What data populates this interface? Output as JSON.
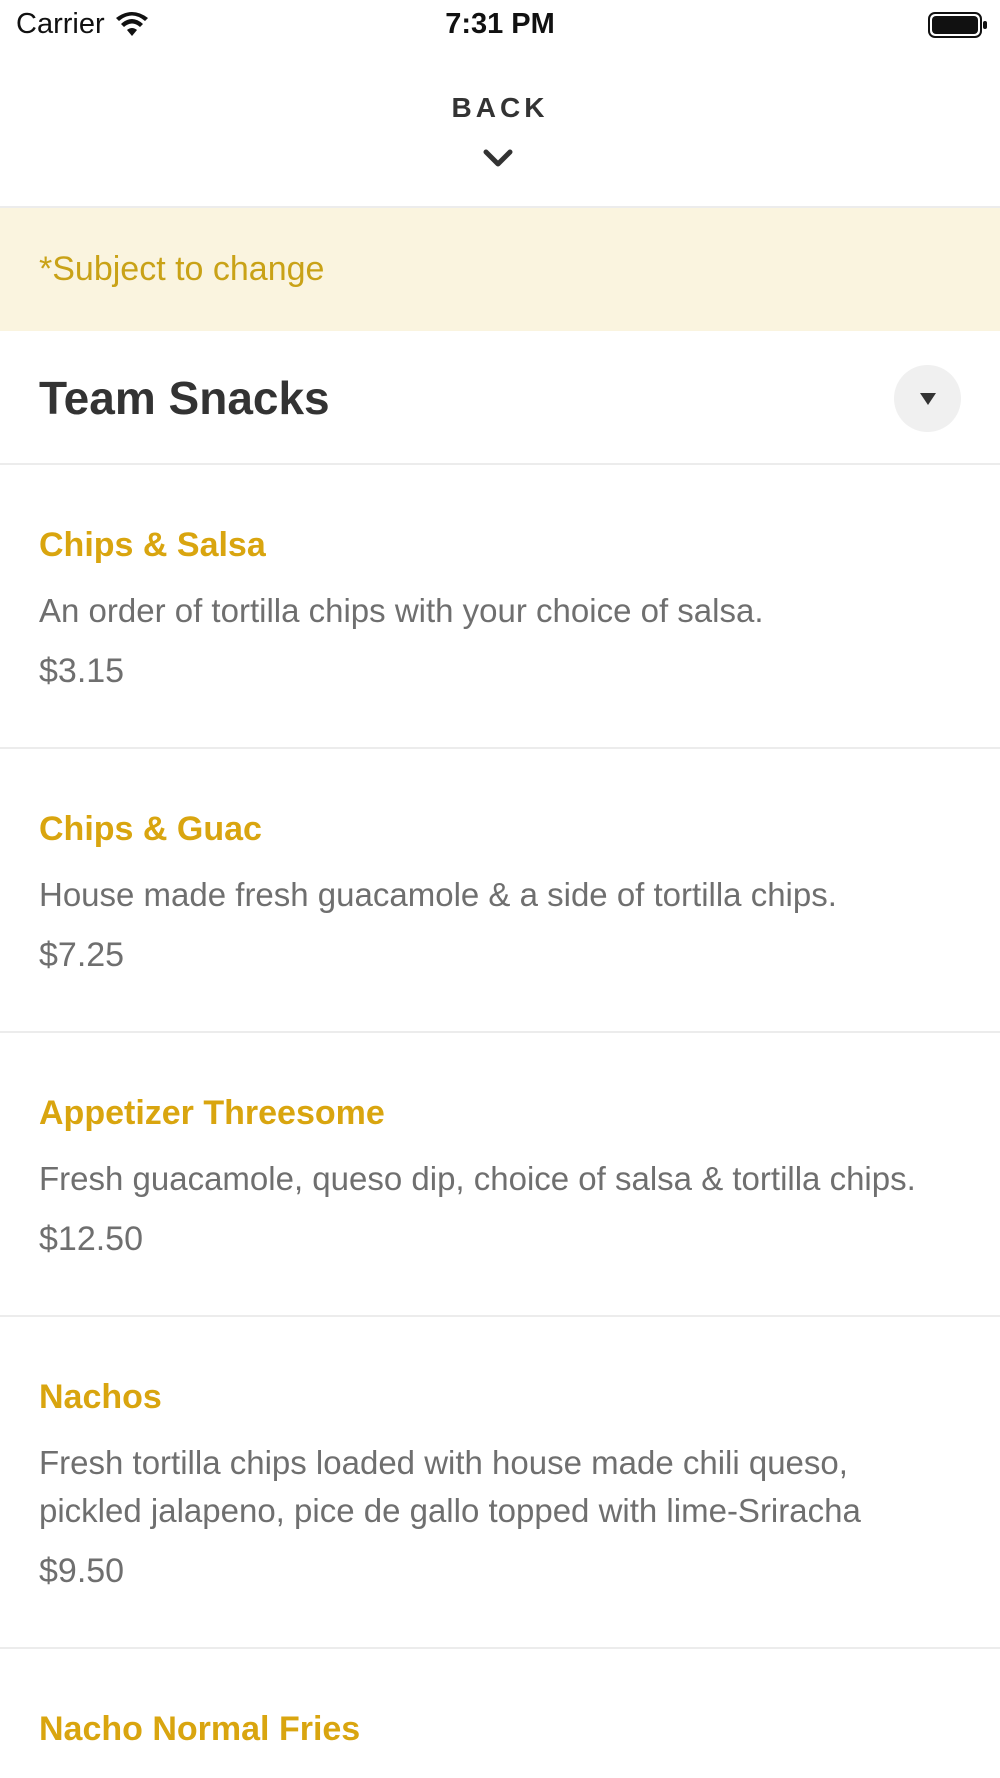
{
  "status_bar": {
    "carrier": "Carrier",
    "time": "7:31 PM"
  },
  "header": {
    "back_label": "BACK"
  },
  "notice": {
    "text": "*Subject to change"
  },
  "section": {
    "title": "Team Snacks"
  },
  "menu_items": [
    {
      "name": "Chips & Salsa",
      "description": "An order of tortilla chips with your choice of salsa.",
      "price": "$3.15"
    },
    {
      "name": "Chips & Guac",
      "description": "House made fresh guacamole & a side of tortilla chips.",
      "price": "$7.25"
    },
    {
      "name": "Appetizer Threesome",
      "description": "Fresh guacamole, queso dip, choice of salsa & tortilla chips.",
      "price": "$12.50"
    },
    {
      "name": "Nachos",
      "description": "Fresh tortilla chips loaded with house made chili queso, pickled jalapeno, pice de gallo topped with lime-Sriracha",
      "price": "$9.50"
    },
    {
      "name": "Nacho Normal Fries",
      "description": "",
      "price": ""
    }
  ],
  "colors": {
    "accent": "#d9a50f",
    "notice_bg": "#faf4df",
    "notice_text": "#c9a217"
  }
}
